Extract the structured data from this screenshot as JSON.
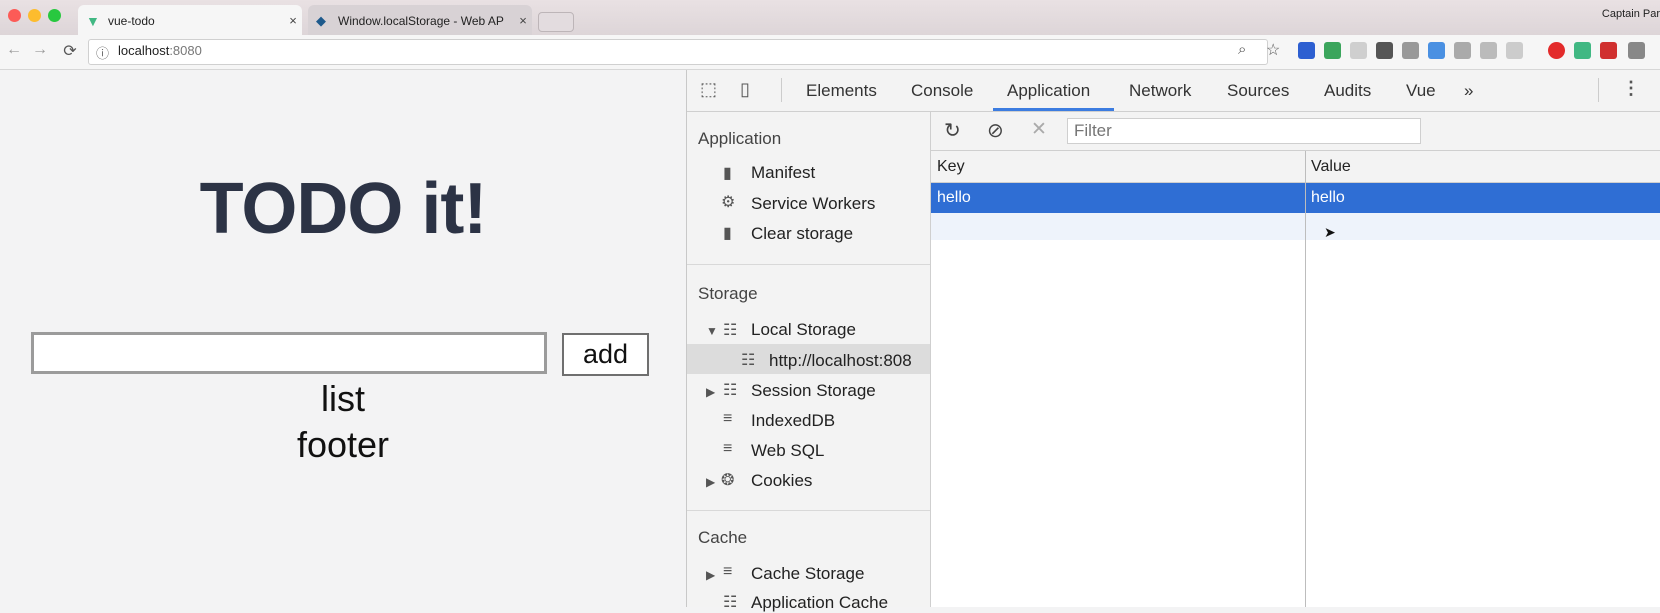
{
  "browser": {
    "tabs": [
      {
        "title": "vue-todo",
        "close": "×"
      },
      {
        "title": "Window.localStorage - Web AP",
        "close": "×"
      }
    ],
    "profile_name": "Captain Par",
    "url_host": "localhost",
    "url_port": ":8080",
    "nav": {
      "back": "←",
      "forward": "→",
      "reload": "⟳"
    },
    "colors": {
      "vue_green": "#41b883",
      "accent": "#3c7ce0"
    }
  },
  "page": {
    "heading": "TODO it!",
    "input_value": "",
    "add_label": "add",
    "list_text": "list",
    "footer_text": "footer"
  },
  "devtools": {
    "tabs": [
      "Elements",
      "Console",
      "Application",
      "Network",
      "Sources",
      "Audits",
      "Vue",
      "»"
    ],
    "active_tab": "Application",
    "sidebar": {
      "application_header": "Application",
      "application_items": [
        "Manifest",
        "Service Workers",
        "Clear storage"
      ],
      "storage_header": "Storage",
      "local_storage": "Local Storage",
      "local_storage_origin": "http://localhost:808",
      "session_storage": "Session Storage",
      "indexeddb": "IndexedDB",
      "web_sql": "Web SQL",
      "cookies": "Cookies",
      "cache_header": "Cache",
      "cache_storage": "Cache Storage",
      "application_cache": "Application Cache"
    },
    "storage": {
      "filter_placeholder": "Filter",
      "columns": [
        "Key",
        "Value"
      ],
      "rows": [
        {
          "key": "hello",
          "value": "hello"
        }
      ]
    }
  }
}
